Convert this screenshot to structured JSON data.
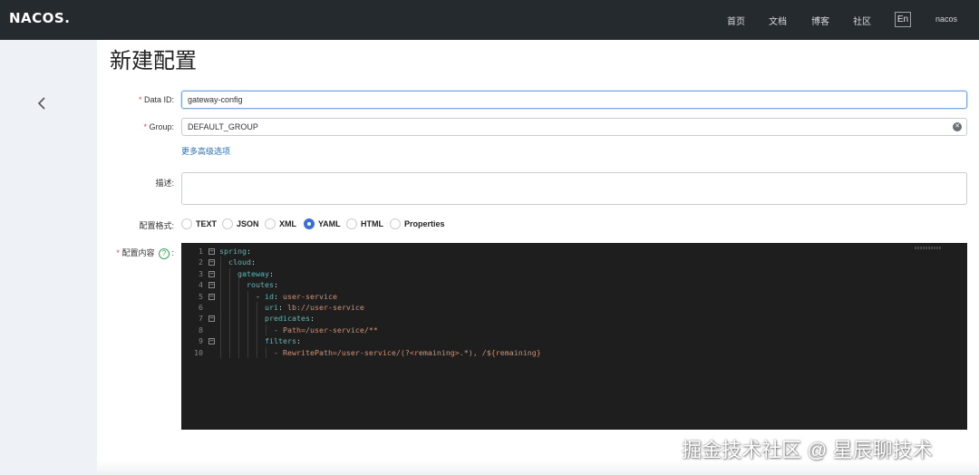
{
  "header": {
    "logo": "NACOS.",
    "nav": [
      "首页",
      "文档",
      "博客",
      "社区"
    ],
    "lang": "En",
    "user": "nacos"
  },
  "page": {
    "title": "新建配置"
  },
  "form": {
    "data_id": {
      "label": "Data ID:",
      "value": "gateway-config"
    },
    "group": {
      "label": "Group:",
      "value": "DEFAULT_GROUP"
    },
    "advanced_link": "更多高级选项",
    "description": {
      "label": "描述:",
      "value": ""
    },
    "format": {
      "label": "配置格式:",
      "options": [
        "TEXT",
        "JSON",
        "XML",
        "YAML",
        "HTML",
        "Properties"
      ],
      "selected": "YAML"
    },
    "content": {
      "label": "配置内容",
      "colon": ":",
      "help": "?"
    }
  },
  "editor": {
    "lines": [
      {
        "n": "1",
        "indent": 0,
        "key": "spring",
        "sep": ":",
        "val": ""
      },
      {
        "n": "2",
        "indent": 1,
        "key": "cloud",
        "sep": ":",
        "val": ""
      },
      {
        "n": "3",
        "indent": 2,
        "key": "gateway",
        "sep": ":",
        "val": ""
      },
      {
        "n": "4",
        "indent": 3,
        "key": "routes",
        "sep": ":",
        "val": ""
      },
      {
        "n": "5",
        "indent": 4,
        "key": "- id",
        "sep": ": ",
        "val": "user-service"
      },
      {
        "n": "6",
        "indent": 5,
        "key": "uri",
        "sep": ": ",
        "val": "lb://user-service"
      },
      {
        "n": "7",
        "indent": 5,
        "key": "predicates",
        "sep": ":",
        "val": ""
      },
      {
        "n": "8",
        "indent": 6,
        "key": "",
        "sep": "",
        "val": "- Path=/user-service/**"
      },
      {
        "n": "9",
        "indent": 5,
        "key": "filters",
        "sep": ":",
        "val": ""
      },
      {
        "n": "10",
        "indent": 6,
        "key": "",
        "sep": "",
        "val": "- RewritePath=/user-service/(?<remaining>.*), /${remaining}"
      }
    ],
    "folds": [
      "1",
      "2",
      "3",
      "4",
      "5",
      "7",
      "9"
    ]
  },
  "watermark": "掘金技术社区 @ 星辰聊技术"
}
